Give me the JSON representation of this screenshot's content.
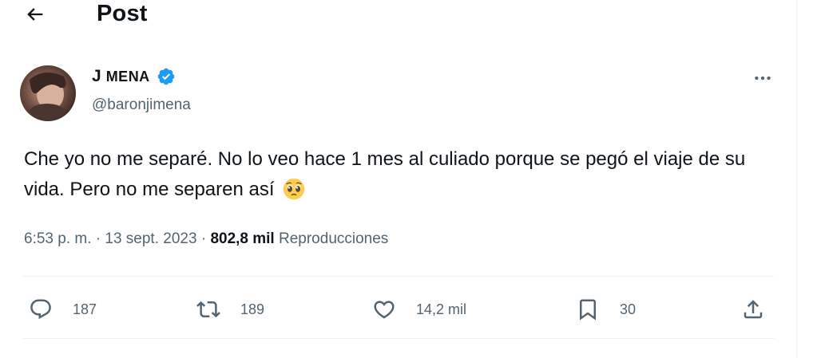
{
  "header": {
    "title": "Post"
  },
  "author": {
    "name_initial": "J",
    "name_rest": "MENA",
    "handle": "@baronjimena"
  },
  "tweet": {
    "text": "Che yo no me separé. No lo veo hace 1 mes al culiado porque se pegó el viaje de su vida. Pero no me separen así",
    "emoji": "pleading-face",
    "time": "6:53 p. m.",
    "separator": "·",
    "date": "13 sept. 2023",
    "views": "802,8 mil",
    "views_label": "Reproducciones"
  },
  "actions": {
    "replies": "187",
    "reposts": "189",
    "likes": "14,2 mil",
    "bookmarks": "30"
  },
  "colors": {
    "verified": "#1d9bf0",
    "text_primary": "#0f1419",
    "text_secondary": "#536471",
    "divider": "#eff3f4"
  }
}
